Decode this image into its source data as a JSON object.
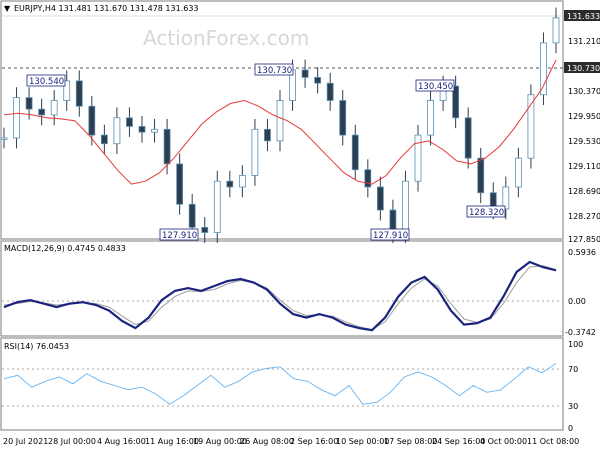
{
  "window": {
    "symbol_header": "EURJPY,H4 131.481 131.670 131.478 131.633",
    "watermark": "ActionForex.com"
  },
  "colors": {
    "candles": "#2c3e50",
    "candle_outline": "#5b8fb0",
    "moving_average": "#e53935",
    "macd_line": "#1a237e",
    "macd_signal": "#9e9e9e",
    "rsi_line": "#64b5f6",
    "price_highlight_bg": "#2b2b2b"
  },
  "price_panel": {
    "axis_labels": [
      "131.633",
      "131.210",
      "130.730",
      "130.370",
      "129.950",
      "129.530",
      "129.110",
      "128.690",
      "128.270",
      "127.850"
    ],
    "current_price_label": "131.633",
    "level_line_label": "130.730",
    "annotations": [
      {
        "text": "130.540"
      },
      {
        "text": "130.730"
      },
      {
        "text": "130.450"
      },
      {
        "text": "127.910"
      },
      {
        "text": "127.910"
      },
      {
        "text": "128.320"
      }
    ]
  },
  "macd_panel": {
    "title": "MACD(12,26,9) 0.4745 0.4833",
    "axis_labels": [
      "0.5936",
      "0.00",
      "-0.3742"
    ]
  },
  "rsi_panel": {
    "title": "RSI(14) 76.0453",
    "axis_labels": [
      "100",
      "70",
      "30",
      "0"
    ]
  },
  "x_axis": {
    "labels": [
      "20 Jul 2021",
      "28 Jul 00:00",
      "4 Aug 16:00",
      "11 Aug 16:00",
      "19 Aug 00:00",
      "26 Aug 08:00",
      "2 Sep 16:00",
      "10 Sep 00:00",
      "17 Sep 08:00",
      "24 Sep 16:00",
      "4 Oct 00:00",
      "11 Oct 08:00"
    ]
  },
  "chart_data": [
    {
      "type": "line",
      "title": "EURJPY,H4 131.481 131.670 131.478 131.633",
      "series": [
        {
          "name": "",
          "values": [
            129.55,
            130.25,
            130.05,
            129.95,
            130.2,
            130.54,
            130.1,
            129.6,
            129.45,
            129.9,
            129.75,
            129.65,
            129.7,
            129.1,
            128.4,
            128.0,
            127.91,
            128.8,
            128.7,
            128.9,
            129.7,
            129.5,
            130.2,
            130.73,
            130.6,
            130.5,
            130.2,
            129.6,
            129.0,
            128.7,
            128.3,
            127.91,
            128.8,
            129.6,
            130.2,
            130.45,
            129.9,
            129.2,
            128.6,
            128.32,
            128.7,
            129.2,
            130.3,
            131.2,
            131.633
          ]
        },
        {
          "name": "",
          "values": [
            129.95,
            129.98,
            129.95,
            129.9,
            129.88,
            129.85,
            129.6,
            129.3,
            129.0,
            128.75,
            128.8,
            128.95,
            129.2,
            129.5,
            129.8,
            130.0,
            130.15,
            130.2,
            130.1,
            129.95,
            129.85,
            129.7,
            129.45,
            129.2,
            128.95,
            128.8,
            128.75,
            128.9,
            129.2,
            129.45,
            129.5,
            129.35,
            129.15,
            129.1,
            129.2,
            129.4,
            129.7,
            130.05,
            130.4,
            130.9
          ]
        }
      ],
      "ylim": [
        127.85,
        131.7
      ],
      "annotations": [
        "130.540",
        "130.730",
        "130.450",
        "127.910",
        "127.910",
        "128.320"
      ],
      "reference_lines": [
        130.73
      ]
    },
    {
      "type": "line",
      "title": "MACD(12,26,9) 0.4745 0.4833",
      "series": [
        {
          "name": "",
          "values": [
            -0.05,
            0.02,
            0.05,
            0.0,
            -0.05,
            0.0,
            0.02,
            -0.02,
            -0.1,
            -0.25,
            -0.35,
            -0.2,
            0.05,
            0.18,
            0.22,
            0.18,
            0.25,
            0.32,
            0.35,
            0.3,
            0.2,
            0.0,
            -0.15,
            -0.2,
            -0.15,
            -0.2,
            -0.3,
            -0.35,
            -0.38,
            -0.2,
            0.1,
            0.3,
            0.38,
            0.2,
            -0.1,
            -0.3,
            -0.28,
            -0.2,
            0.1,
            0.45,
            0.5936,
            0.52,
            0.4745
          ]
        },
        {
          "name": "",
          "values": [
            -0.02,
            0.0,
            0.03,
            0.01,
            -0.02,
            0.0,
            0.01,
            0.0,
            -0.05,
            -0.18,
            -0.3,
            -0.25,
            -0.05,
            0.1,
            0.18,
            0.17,
            0.2,
            0.28,
            0.33,
            0.3,
            0.22,
            0.05,
            -0.1,
            -0.17,
            -0.16,
            -0.18,
            -0.26,
            -0.33,
            -0.37,
            -0.26,
            0.0,
            0.22,
            0.35,
            0.25,
            0.0,
            -0.22,
            -0.27,
            -0.22,
            0.0,
            0.3,
            0.52,
            0.54,
            0.4833
          ]
        }
      ],
      "ylim": [
        -0.42,
        0.65
      ],
      "reference_lines": [
        0.0
      ]
    },
    {
      "type": "line",
      "title": "RSI(14) 76.0453",
      "series": [
        {
          "name": "",
          "values": [
            58,
            62,
            48,
            55,
            60,
            52,
            64,
            55,
            50,
            45,
            48,
            40,
            28,
            38,
            50,
            62,
            48,
            55,
            66,
            70,
            72,
            58,
            55,
            45,
            38,
            50,
            28,
            30,
            42,
            60,
            66,
            60,
            50,
            38,
            50,
            42,
            45,
            58,
            72,
            65,
            76.0453
          ]
        }
      ],
      "ylim": [
        0,
        100
      ],
      "reference_lines": [
        30,
        70
      ]
    }
  ]
}
